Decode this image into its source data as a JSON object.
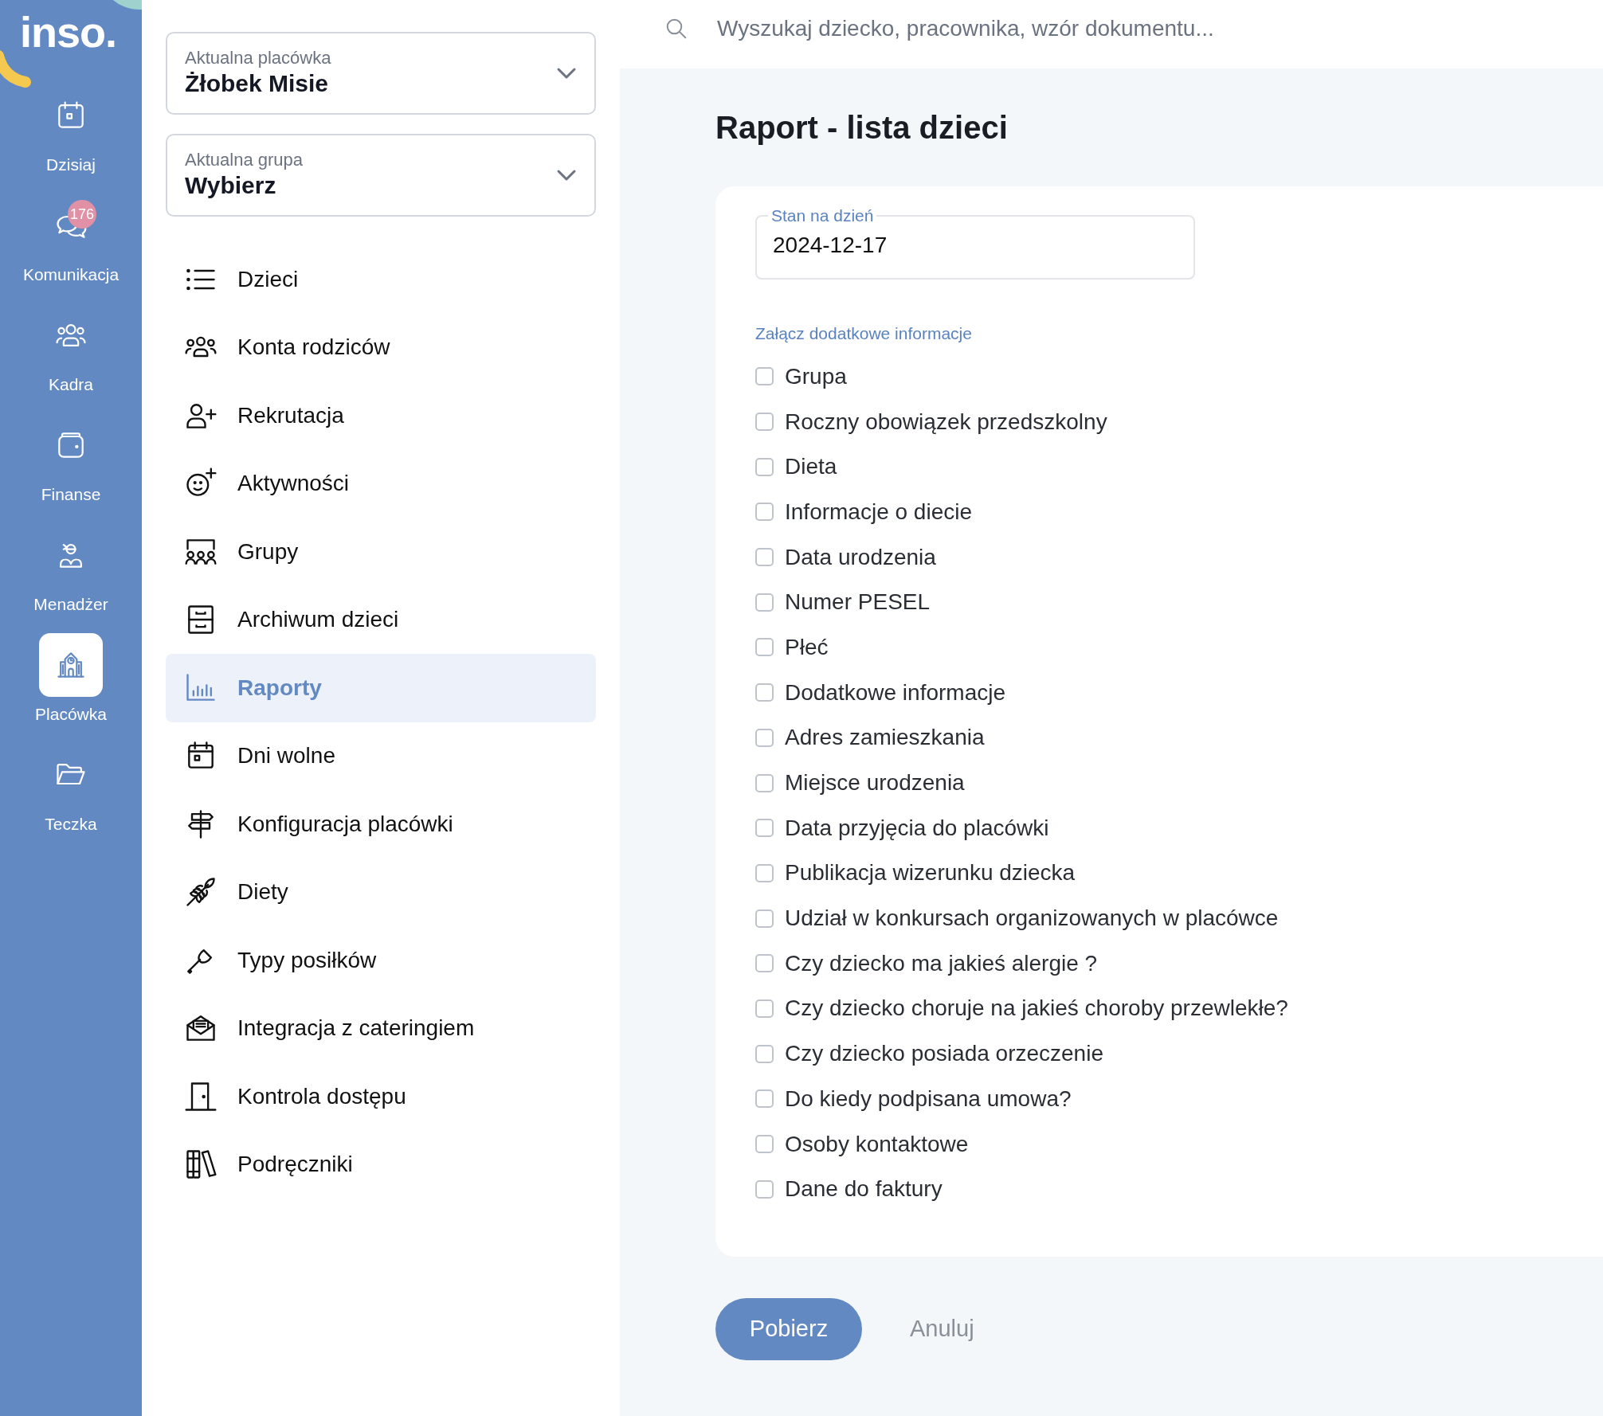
{
  "rail": {
    "logo": "inso.",
    "items": [
      {
        "label": "Dzisiaj",
        "selected": false
      },
      {
        "label": "Komunikacja",
        "selected": false,
        "badge": "176"
      },
      {
        "label": "Kadra",
        "selected": false
      },
      {
        "label": "Finanse",
        "selected": false
      },
      {
        "label": "Menadżer",
        "selected": false
      },
      {
        "label": "Placówka",
        "selected": true
      },
      {
        "label": "Teczka",
        "selected": false
      }
    ]
  },
  "sidebar": {
    "selects": [
      {
        "label": "Aktualna placówka",
        "value": "Żłobek Misie"
      },
      {
        "label": "Aktualna grupa",
        "value": "Wybierz"
      }
    ],
    "items": [
      {
        "label": "Dzieci",
        "selected": false
      },
      {
        "label": "Konta rodziców",
        "selected": false
      },
      {
        "label": "Rekrutacja",
        "selected": false
      },
      {
        "label": "Aktywności",
        "selected": false
      },
      {
        "label": "Grupy",
        "selected": false
      },
      {
        "label": "Archiwum dzieci",
        "selected": false
      },
      {
        "label": "Raporty",
        "selected": true
      },
      {
        "label": "Dni wolne",
        "selected": false
      },
      {
        "label": "Konfiguracja placówki",
        "selected": false
      },
      {
        "label": "Diety",
        "selected": false
      },
      {
        "label": "Typy posiłków",
        "selected": false
      },
      {
        "label": "Integracja z cateringiem",
        "selected": false
      },
      {
        "label": "Kontrola dostępu",
        "selected": false
      },
      {
        "label": "Podręczniki",
        "selected": false
      }
    ]
  },
  "search": {
    "placeholder": "Wyszukaj dziecko, pracownika, wzór dokumentu..."
  },
  "page": {
    "title": "Raport - lista dzieci",
    "date_field": {
      "label": "Stan na dzień",
      "value": "2024-12-17"
    },
    "section_label": "Załącz dodatkowe informacje",
    "options": [
      {
        "label": "Grupa",
        "checked": false
      },
      {
        "label": "Roczny obowiązek przedszkolny",
        "checked": false
      },
      {
        "label": "Dieta",
        "checked": false
      },
      {
        "label": "Informacje o diecie",
        "checked": false
      },
      {
        "label": "Data urodzenia",
        "checked": false
      },
      {
        "label": "Numer PESEL",
        "checked": false
      },
      {
        "label": "Płeć",
        "checked": false
      },
      {
        "label": "Dodatkowe informacje",
        "checked": false
      },
      {
        "label": "Adres zamieszkania",
        "checked": false
      },
      {
        "label": "Miejsce urodzenia",
        "checked": false
      },
      {
        "label": "Data przyjęcia do placówki",
        "checked": false
      },
      {
        "label": "Publikacja wizerunku dziecka",
        "checked": false
      },
      {
        "label": "Udział w konkursach organizowanych w placówce",
        "checked": false
      },
      {
        "label": "Czy dziecko ma jakieś alergie ?",
        "checked": false
      },
      {
        "label": "Czy dziecko choruje na jakieś choroby przewlekłe?",
        "checked": false
      },
      {
        "label": "Czy dziecko posiada orzeczenie",
        "checked": false
      },
      {
        "label": "Do kiedy podpisana umowa?",
        "checked": false
      },
      {
        "label": "Osoby kontaktowe",
        "checked": false
      },
      {
        "label": "Dane do faktury",
        "checked": false
      }
    ],
    "buttons": [
      {
        "label": "Pobierz",
        "kind": "primary"
      },
      {
        "label": "Anuluj",
        "kind": "secondary"
      }
    ]
  }
}
